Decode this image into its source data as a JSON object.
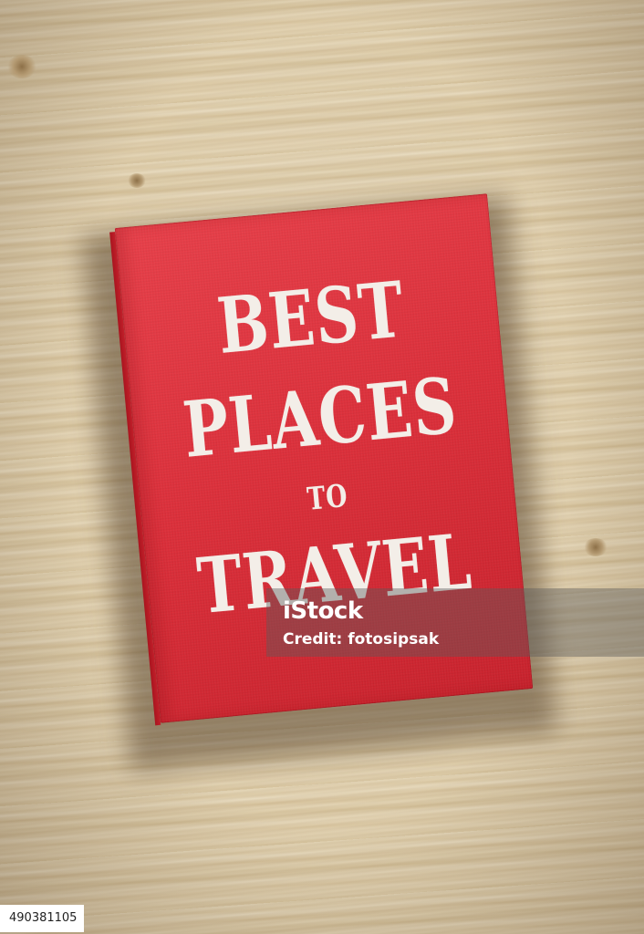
{
  "book": {
    "cover_color": "#dc2f3a",
    "text_color": "#f3eee8",
    "title_line1": "BEST",
    "title_line2": "PLACES",
    "title_line3": "TO",
    "title_line4": "TRAVEL"
  },
  "watermark": {
    "brand": "iStock",
    "credit": "Credit: fotosipsak"
  },
  "image_id": "490381105"
}
